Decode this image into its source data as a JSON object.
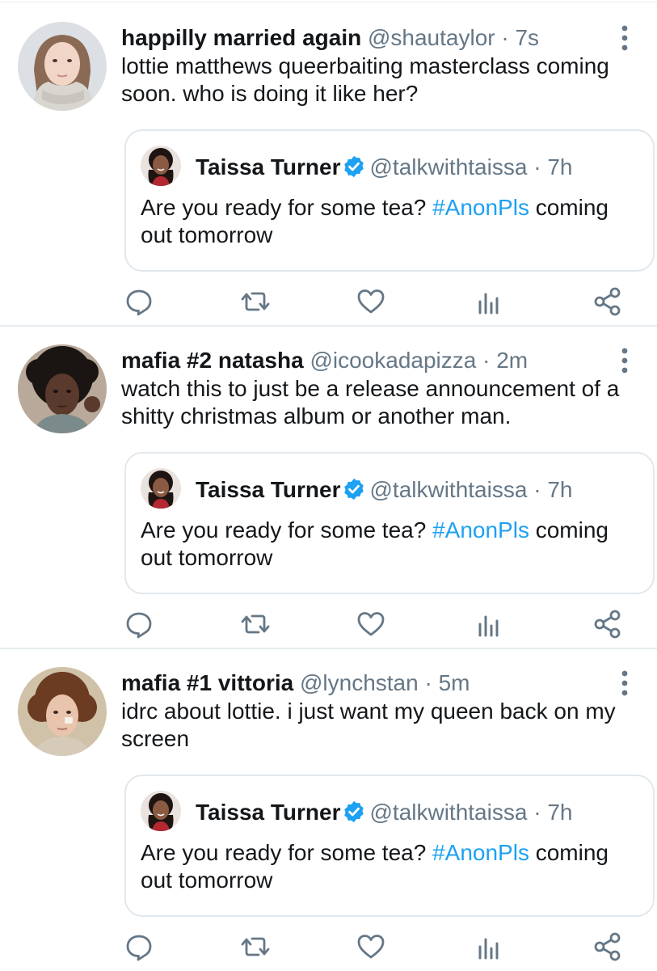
{
  "tweets": [
    {
      "display_name": "happilly married again",
      "handle": "@shautaylor",
      "separator": "·",
      "time": "7s",
      "text": "lottie matthews queerbaiting masterclass coming soon. who is doing it like her?",
      "avatar_icon": "user-avatar-light-hair",
      "quote": {
        "display_name": "Taissa Turner",
        "handle": "@talkwithtaissa",
        "separator": "·",
        "time": "7h",
        "text_prefix": "Are you ready for some tea? ",
        "hashtag": "#AnonPls",
        "text_suffix": " coming out tomorrow"
      }
    },
    {
      "display_name": "mafia #2 natasha",
      "handle": "@icookadapizza",
      "separator": "·",
      "time": "2m",
      "text": "watch this to just be a release announcement of a shitty christmas album or another man.",
      "avatar_icon": "user-avatar-dark-curly-hair",
      "quote": {
        "display_name": "Taissa Turner",
        "handle": "@talkwithtaissa",
        "separator": "·",
        "time": "7h",
        "text_prefix": "Are you ready for some tea? ",
        "hashtag": "#AnonPls",
        "text_suffix": " coming out tomorrow"
      }
    },
    {
      "display_name": "mafia #1 vittoria",
      "handle": "@lynchstan",
      "separator": "·",
      "time": "5m",
      "text": "idrc about lottie. i just want my queen back on my screen",
      "avatar_icon": "user-avatar-curly-auburn-hair",
      "quote": {
        "display_name": "Taissa Turner",
        "handle": "@talkwithtaissa",
        "separator": "·",
        "time": "7h",
        "text_prefix": "Are you ready for some tea? ",
        "hashtag": "#AnonPls",
        "text_suffix": " coming out tomorrow"
      }
    }
  ],
  "icons": {
    "reply": "reply-icon",
    "retweet": "retweet-icon",
    "like": "heart-icon",
    "analytics": "analytics-icon",
    "share": "share-icon",
    "more": "more-vertical-icon",
    "verified": "verified-badge-icon"
  },
  "colors": {
    "text": "#14171a",
    "muted": "#657786",
    "accent": "#1da1f2",
    "border": "#e1e8ed"
  }
}
